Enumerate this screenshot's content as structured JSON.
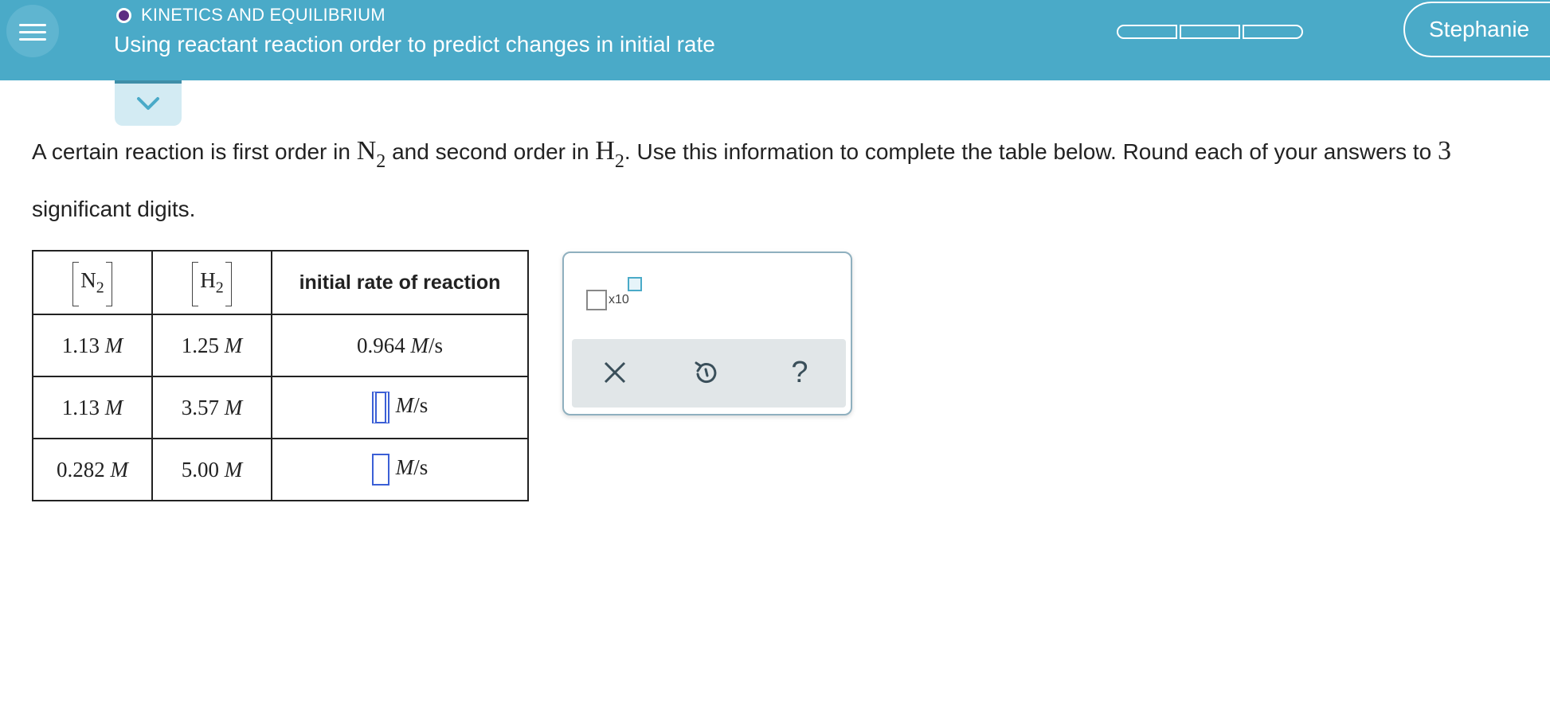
{
  "header": {
    "topic": "KINETICS AND EQUILIBRIUM",
    "title": "Using reactant reaction order to predict changes in initial rate",
    "user_name": "Stephanie",
    "topic_dot_color": "#5c2c82",
    "bar_color": "#4aaac8"
  },
  "question": {
    "part1": "A certain reaction is first order in ",
    "species1": "N",
    "species1_sub": "2",
    "part2": " and second order in ",
    "species2": "H",
    "species2_sub": "2",
    "part3": ". Use this information to complete the table below. Round each of your answers to ",
    "sig_digits": "3",
    "part4": " significant digits."
  },
  "table": {
    "headers": {
      "n2": "N",
      "n2_sub": "2",
      "h2": "H",
      "h2_sub": "2",
      "rate": "initial rate of reaction"
    },
    "rows": [
      {
        "n2": "1.13",
        "n2_unit": "M",
        "h2": "1.25",
        "h2_unit": "M",
        "rate": "0.964",
        "rate_unit_m": "M",
        "rate_unit_s": "/s"
      },
      {
        "n2": "1.13",
        "n2_unit": "M",
        "h2": "3.57",
        "h2_unit": "M",
        "rate": "",
        "rate_unit_m": "M",
        "rate_unit_s": "/s"
      },
      {
        "n2": "0.282",
        "n2_unit": "M",
        "h2": "5.00",
        "h2_unit": "M",
        "rate": "",
        "rate_unit_m": "M",
        "rate_unit_s": "/s"
      }
    ]
  },
  "palette": {
    "sci_label": "x10",
    "clear_icon": "close-icon",
    "undo_icon": "undo-icon",
    "help_label": "?"
  }
}
